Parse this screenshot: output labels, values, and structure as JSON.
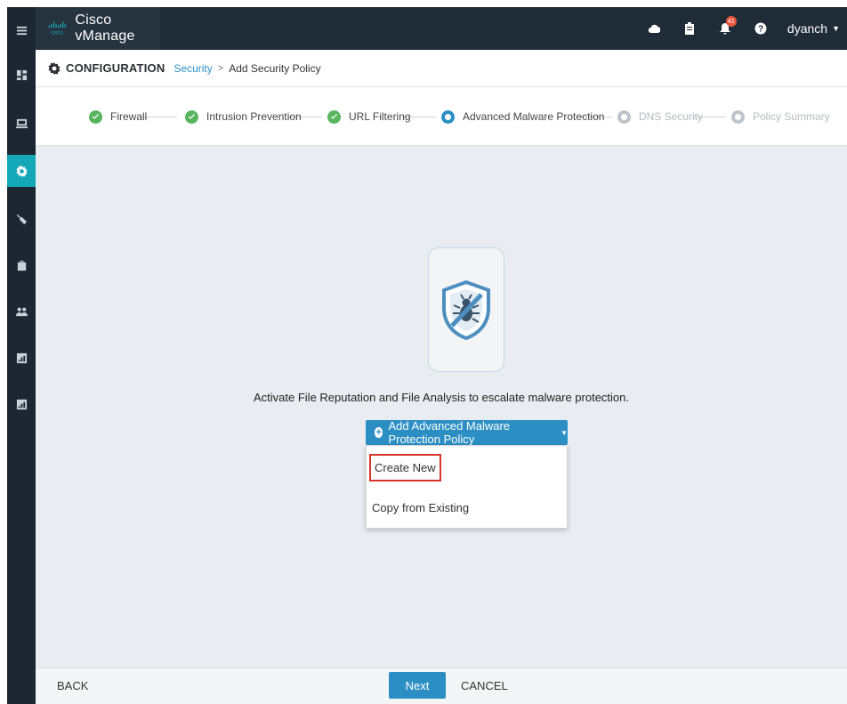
{
  "app": {
    "title": "Cisco vManage",
    "logo_text": "cisco"
  },
  "topbar": {
    "icons": [
      "cloud-icon",
      "clipboard-icon",
      "bell-icon",
      "help-icon"
    ],
    "notification_count": "41",
    "user": "dyanch"
  },
  "breadcrumb": {
    "section": "CONFIGURATION",
    "link": "Security",
    "separator": ">",
    "current": "Add Security Policy"
  },
  "steps": [
    {
      "label": "Firewall",
      "state": "done"
    },
    {
      "label": "Intrusion Prevention",
      "state": "done"
    },
    {
      "label": "URL Filtering",
      "state": "done"
    },
    {
      "label": "Advanced Malware Protection",
      "state": "current"
    },
    {
      "label": "DNS Security",
      "state": "pending"
    },
    {
      "label": "Policy Summary",
      "state": "pending"
    }
  ],
  "main": {
    "description": "Activate File Reputation and File Analysis to escalate malware protection.",
    "add_button": "Add Advanced Malware Protection Policy",
    "dropdown": [
      "Create New",
      "Copy from Existing"
    ]
  },
  "footer": {
    "back": "BACK",
    "next": "Next",
    "cancel": "CANCEL"
  },
  "colors": {
    "accent": "#2c8fc4",
    "success": "#58b55e",
    "rail_active": "#14a8b9",
    "highlight_border": "#d9342b"
  },
  "sidebar_icons": [
    "menu-icon",
    "dashboard-icon",
    "monitor-icon",
    "configuration-icon",
    "tools-icon",
    "maintenance-icon",
    "administration-icon",
    "analytics-icon",
    "reports-icon"
  ]
}
